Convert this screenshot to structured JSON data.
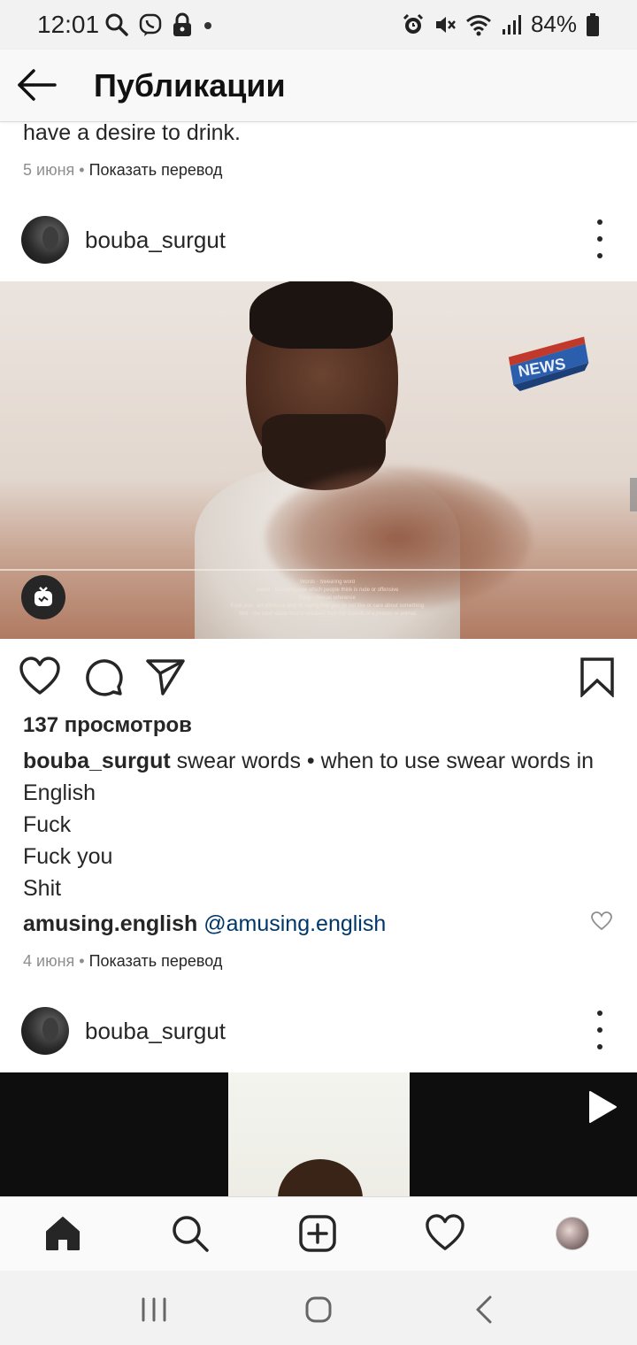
{
  "status_bar": {
    "time": "12:01",
    "battery": "84%",
    "left_icons": [
      "search-icon",
      "viber-icon",
      "lock-icon",
      "dot-icon"
    ],
    "right_icons": [
      "alarm-icon",
      "mute-icon",
      "wifi-icon",
      "signal-icon",
      "battery-icon"
    ]
  },
  "header": {
    "title": "Публикации",
    "back_icon": "arrow-left-icon"
  },
  "previous_post": {
    "caption_tail": "have a desire to drink.",
    "date": "5 июня",
    "separator": " • ",
    "translate": "Показать перевод"
  },
  "post": {
    "username": "bouba_surgut",
    "views": "137 просмотров",
    "caption_user": "bouba_surgut",
    "caption_text": " swear words • when to use swear words in English",
    "caption_lines": [
      "Fuck",
      "Fuck you",
      "Shit"
    ],
    "comment_user": "amusing.english",
    "comment_mention": "@amusing.english",
    "date": "4 июня",
    "separator": " • ",
    "translate": "Показать перевод",
    "video_overlay_text": "NEWS",
    "video_subtitles": [
      "Words · Swearing word",
      "swear · bad language which people think is rude or offensive",
      "Fuck · Sexual reference",
      "Fuck you · an offensive way of saying that you do not like or care about something",
      "Shit · the solid waste that is released from the bowels of a person or animal"
    ]
  },
  "next_post": {
    "username": "bouba_surgut"
  },
  "bottom_nav": {
    "items": [
      "home-icon",
      "search-icon",
      "new-post-icon",
      "activity-icon",
      "profile-avatar"
    ]
  },
  "system_nav": {
    "items": [
      "recent-apps-icon",
      "home-button-icon",
      "back-chevron-icon"
    ]
  }
}
